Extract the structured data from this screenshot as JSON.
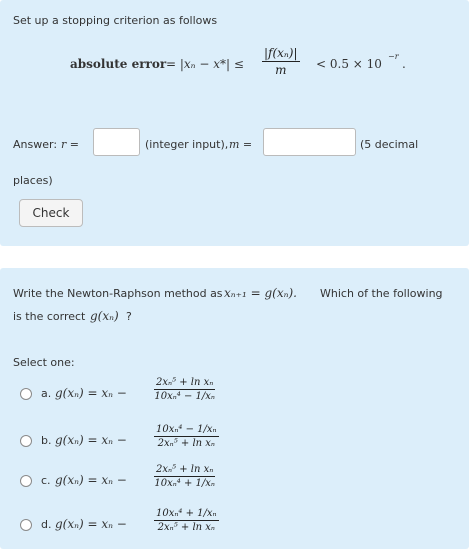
{
  "question1": {
    "intro": "Set up a stopping criterion as follows",
    "criterion": {
      "label": "absolute error",
      "lhs": "= |xₙ − x*| ≤",
      "frac_num": "|f(xₙ)|",
      "frac_den": "m",
      "rhs": "< 0.5 × 10",
      "exponent": "−r",
      "end": "."
    },
    "answer_label": "Answer:",
    "answer_var_r": "r =",
    "r_input_value": "",
    "integer_note": "(integer input),",
    "answer_var_m": "m =",
    "m_input_value": "",
    "decimal_note_1": "(5 decimal",
    "decimal_note_2": "places)",
    "check_button": "Check"
  },
  "question2": {
    "prompt_1a": "Write the Newton-Raphson method as",
    "prompt_formula": "xₙ₊₁ = g(xₙ).",
    "prompt_1b": "Which of the following",
    "prompt_2a": "is the correct",
    "prompt_2_formula": "g(xₙ)",
    "prompt_2b": "?",
    "select_label": "Select one:",
    "options": [
      {
        "letter": "a.",
        "lhs": "g(xₙ) = xₙ −",
        "num": "2xₙ⁵ + ln xₙ",
        "den": "10xₙ⁴ − 1/xₙ"
      },
      {
        "letter": "b.",
        "lhs": "g(xₙ) = xₙ −",
        "num": "10xₙ⁴ − 1/xₙ",
        "den": "2xₙ⁵ + ln xₙ"
      },
      {
        "letter": "c.",
        "lhs": "g(xₙ) = xₙ −",
        "num": "2xₙ⁵ + ln xₙ",
        "den": "10xₙ⁴ + 1/xₙ"
      },
      {
        "letter": "d.",
        "lhs": "g(xₙ) = xₙ −",
        "num": "10xₙ⁴ + 1/xₙ",
        "den": "2xₙ⁵ + ln xₙ"
      }
    ]
  }
}
